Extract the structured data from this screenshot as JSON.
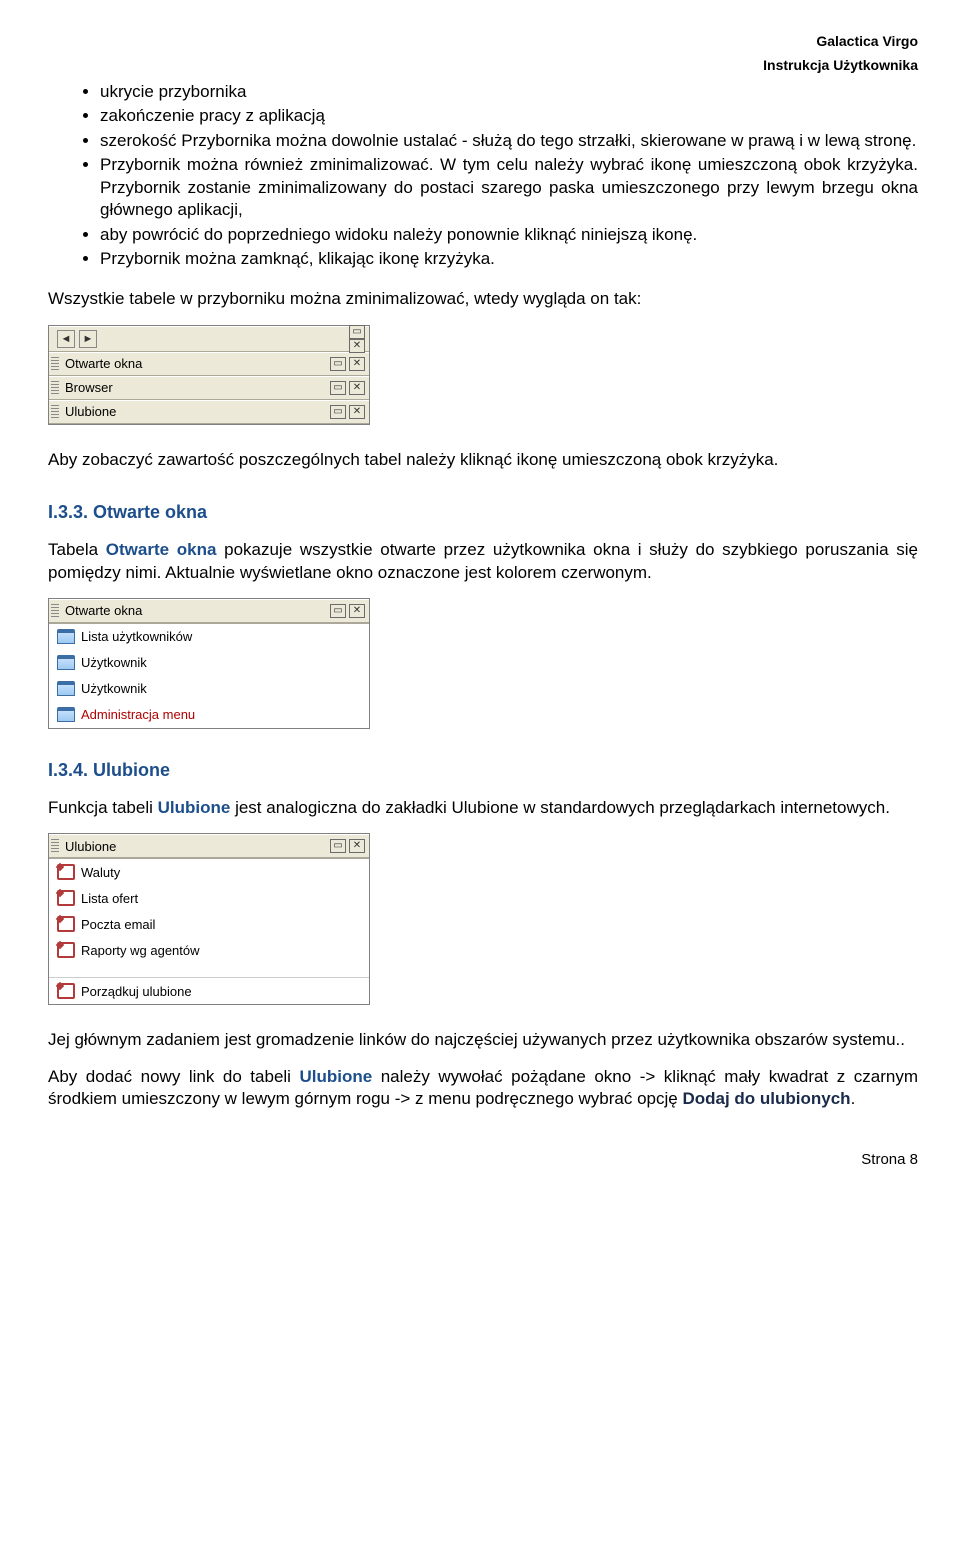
{
  "header": {
    "brand": "Galactica Virgo",
    "subtitle": "Instrukcja Użytkownika"
  },
  "bullets": [
    "ukrycie przybornika",
    "zakończenie pracy z aplikacją",
    "szerokość Przybornika można dowolnie ustalać - służą do tego strzałki, skierowane w prawą i w lewą stronę.",
    "Przybornik można również zminimalizować. W tym celu należy wybrać ikonę umieszczoną obok krzyżyka. Przybornik zostanie zminimalizowany do postaci szarego paska umieszczonego przy lewym brzegu okna głównego aplikacji,",
    "aby powrócić do poprzedniego widoku należy ponownie kliknąć niniejszą ikonę.",
    "Przybornik można zamknąć, klikając ikonę krzyżyka."
  ],
  "para1": "Wszystkie tabele w przyborniku można zminimalizować, wtedy wygląda on tak:",
  "panel1": {
    "rows": [
      "Otwarte okna",
      "Browser",
      "Ulubione"
    ]
  },
  "para2": "Aby zobaczyć zawartość poszczególnych tabel należy kliknąć ikonę umieszczoną obok krzyżyka.",
  "section33": {
    "heading": "I.3.3. Otwarte okna",
    "text_pre": "Tabela ",
    "text_bold": "Otwarte okna",
    "text_post": " pokazuje wszystkie otwarte przez użytkownika okna i służy do szybkiego poruszania się pomiędzy nimi. Aktualnie wyświetlane okno oznaczone jest kolorem czerwonym."
  },
  "panel2": {
    "title": "Otwarte okna",
    "items": [
      "Lista użytkowników",
      "Użytkownik",
      "Użytkownik",
      "Administracja menu"
    ]
  },
  "section34": {
    "heading": "I.3.4. Ulubione",
    "text_pre": "Funkcja tabeli ",
    "text_bold": "Ulubione",
    "text_post": " jest analogiczna do zakładki Ulubione w standardowych przeglądarkach internetowych."
  },
  "panel3": {
    "title": "Ulubione",
    "items": [
      "Waluty",
      "Lista ofert",
      "Poczta email",
      "Raporty wg agentów"
    ],
    "footer_item": "Porządkuj ulubione"
  },
  "para3": "Jej głównym zadaniem jest gromadzenie linków do najczęściej używanych przez użytkownika obszarów systemu..",
  "para4": {
    "pre": "Aby dodać nowy link do tabeli ",
    "bold1": "Ulubione",
    "mid": " należy wywołać pożądane okno -> kliknąć mały kwadrat z czarnym środkiem umieszczony w lewym górnym rogu -> z menu podręcznego wybrać opcję ",
    "bold2": "Dodaj do ulubionych",
    "post": "."
  },
  "footer": "Strona 8"
}
